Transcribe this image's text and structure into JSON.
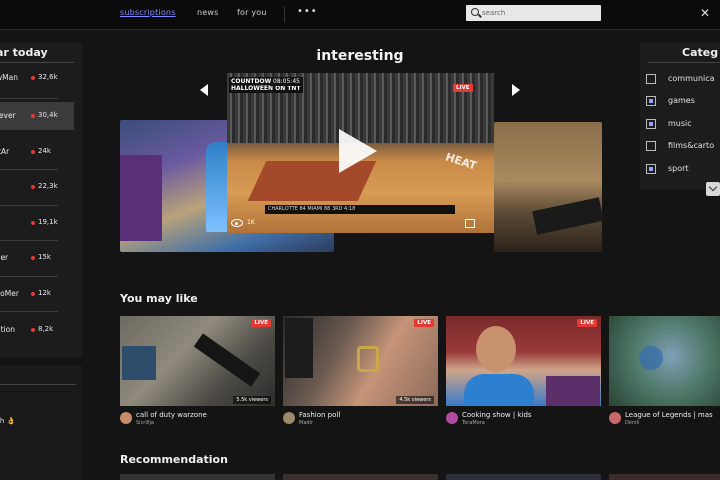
{
  "nav": {
    "subscriptions": "subscriptions",
    "news": "news",
    "for_you": "for you",
    "more": "•••",
    "search_placeholder": "search",
    "corner_icon": "close-icon"
  },
  "popular": {
    "title": "ar today",
    "items": [
      {
        "name": "wMan",
        "count": "32,6k"
      },
      {
        "name": "rever",
        "count": "30,4k"
      },
      {
        "name": "ltAr",
        "count": "24k"
      },
      {
        "name": "",
        "count": "22,3k"
      },
      {
        "name": "",
        "count": "19,1k"
      },
      {
        "name": "ver",
        "count": "15k"
      },
      {
        "name": "lioMer",
        "count": "12k"
      },
      {
        "name": "ation",
        "count": "8,2k"
      }
    ],
    "live_dot_color": "#e53935"
  },
  "left_bottom": {
    "text": "ch 👌"
  },
  "categories": {
    "title": "Categ",
    "items": [
      {
        "label": "communica",
        "checked": false
      },
      {
        "label": "games",
        "checked": true
      },
      {
        "label": "music",
        "checked": true
      },
      {
        "label": "films&carto",
        "checked": false
      },
      {
        "label": "sport",
        "checked": true
      }
    ],
    "accent": "#9a9fff"
  },
  "carousel": {
    "title": "interesting",
    "main": {
      "banner": "COUNTDOWN TO\nHALLOWEEN ON TNT",
      "clock": "08:05:45",
      "live": "LIVE",
      "views": "1K",
      "watermark": "HEAT",
      "scorebar": "CHARLOTTE  84  MIAMI  88     3RD  4:18"
    }
  },
  "you_may_like": {
    "title": "You may like",
    "cards": [
      {
        "title": "call of duty warzone",
        "author": "Sicrillja",
        "viewers": "5.5k viewers",
        "live": "LIVE"
      },
      {
        "title": "Fashion poll",
        "author": "Madir",
        "viewers": "4.5k viewers",
        "live": "LIVE"
      },
      {
        "title": "Cooking show | kids",
        "author": "ToraMora",
        "viewers": "",
        "live": "LIVE"
      },
      {
        "title": "League of Legends | mas",
        "author": "Dimili",
        "viewers": "",
        "live": ""
      }
    ]
  },
  "recommendation": {
    "title": "Recommendation"
  }
}
